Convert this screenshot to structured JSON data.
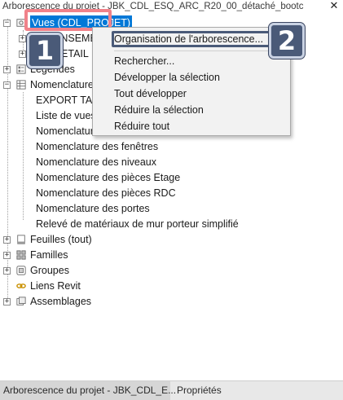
{
  "window": {
    "title": "Arborescence du projet - JBK_CDL_ESQ_ARC_R20_00_détaché_bootc",
    "close_glyph": "✕"
  },
  "tree": {
    "root_label": "Vues (CDL_PROJET)",
    "views_children": [
      "ENSEMBLE",
      "DETAIL"
    ],
    "legends_label": "Légendes",
    "schedules_label": "Nomenclatures/Quantités",
    "schedule_items": [
      "EXPORT TABLEAU",
      "Liste de vues",
      "Nomenclature des murs",
      "Nomenclature des fenêtres",
      "Nomenclature des niveaux",
      "Nomenclature des pièces Etage",
      "Nomenclature des pièces RDC",
      "Nomenclature des portes",
      "Relevé de matériaux de mur porteur simplifié"
    ],
    "sheets_label": "Feuilles (tout)",
    "families_label": "Familles",
    "groups_label": "Groupes",
    "links_label": "Liens Revit",
    "assemblies_label": "Assemblages"
  },
  "context_menu": {
    "items": [
      "Organisation de l'arborescence...",
      "Rechercher...",
      "Développer la sélection",
      "Tout développer",
      "Réduire la sélection",
      "Réduire tout"
    ]
  },
  "annotations": {
    "badge1": "1",
    "badge2": "2"
  },
  "bottom_tabs": [
    "Arborescence du projet - JBK_CDL_E...",
    "Propriétés"
  ],
  "colors": {
    "selection": "#0078d7",
    "highlight_box": "#f0828a",
    "badge": "#4a5a78"
  }
}
